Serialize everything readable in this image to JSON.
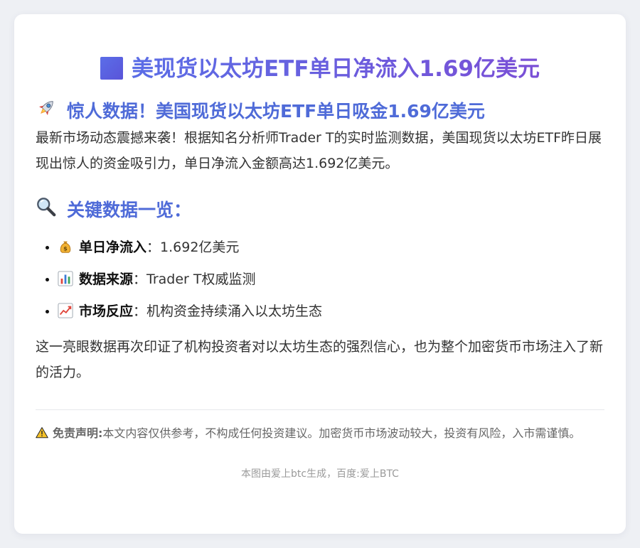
{
  "title": "美现货以太坊ETF单日净流入1.69亿美元",
  "section1": {
    "heading": "惊人数据！美国现货以太坊ETF单日吸金1.69亿美元",
    "icon": "rocket-icon",
    "paragraph": "最新市场动态震撼来袭！根据知名分析师Trader T的实时监测数据，美国现货以太坊ETF昨日展现出惊人的资金吸引力，单日净流入金额高达1.692亿美元。"
  },
  "section2": {
    "heading": "关键数据一览：",
    "icon": "magnifier-icon",
    "points": [
      {
        "icon": "money-bag-icon",
        "label": "单日净流入",
        "sep": "：",
        "value": "1.692亿美元"
      },
      {
        "icon": "bar-chart-icon",
        "label": "数据来源",
        "sep": "：",
        "value": "Trader T权威监测"
      },
      {
        "icon": "trend-up-icon",
        "label": "市场反应",
        "sep": "：",
        "value": "机构资金持续涌入以太坊生态"
      }
    ]
  },
  "conclusion": "这一亮眼数据再次印证了机构投资者对以太坊生态的强烈信心，也为整个加密货币市场注入了新的活力。",
  "disclaimer": {
    "icon": "warning-icon",
    "label": "免责声明:",
    "text": "本文内容仅供参考，不构成任何投资建议。加密货币市场波动较大，投资有风险，入市需谨慎。"
  },
  "footer": "本图由爱上btc生成，百度:爱上BTC",
  "colors": {
    "accent": "#4f6bd8",
    "title_gradient_start": "#5a6de6",
    "title_gradient_end": "#7a4fd6",
    "background": "#eef0f4"
  }
}
